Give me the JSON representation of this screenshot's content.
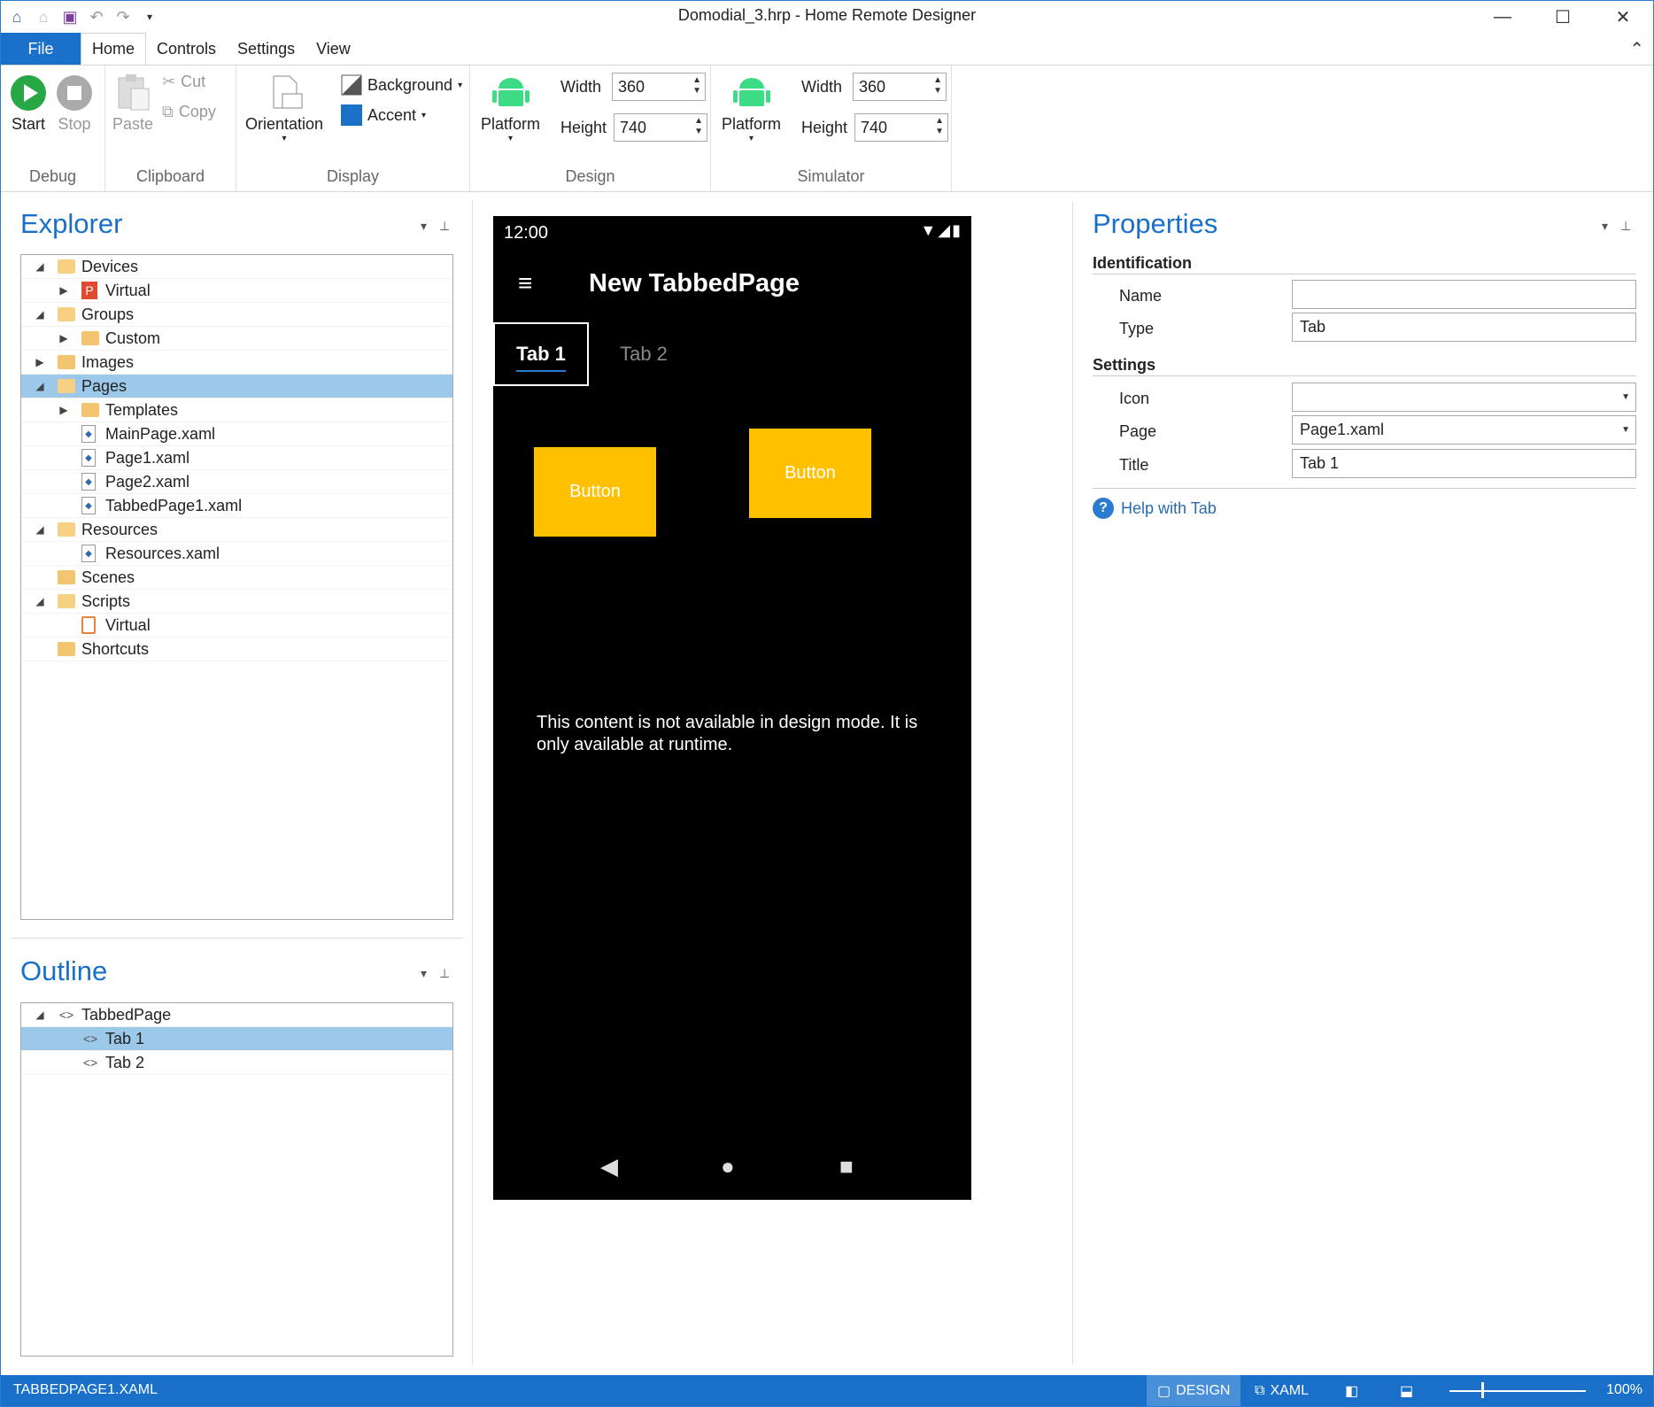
{
  "app": {
    "title": "Domodial_3.hrp - Home Remote Designer"
  },
  "window_controls": {
    "minimize": "—",
    "maximize": "☐",
    "close": "✕"
  },
  "ribbon_tabs": [
    "File",
    "Home",
    "Controls",
    "Settings",
    "View"
  ],
  "ribbon": {
    "debug": {
      "label": "Debug",
      "start": "Start",
      "stop": "Stop"
    },
    "clipboard": {
      "label": "Clipboard",
      "paste": "Paste",
      "cut": "Cut",
      "copy": "Copy"
    },
    "display": {
      "label": "Display",
      "orientation": "Orientation",
      "background": "Background",
      "accent": "Accent",
      "accent_color": "#1a70c8"
    },
    "design": {
      "label": "Design",
      "platform": "Platform",
      "width_label": "Width",
      "width": "360",
      "height_label": "Height",
      "height": "740"
    },
    "simulator": {
      "label": "Simulator",
      "platform": "Platform",
      "width_label": "Width",
      "width": "360",
      "height_label": "Height",
      "height": "740"
    }
  },
  "explorer": {
    "title": "Explorer",
    "items": [
      {
        "label": "Devices",
        "level": 0,
        "expander": "open",
        "icon": "folder-open"
      },
      {
        "label": "Virtual",
        "level": 1,
        "expander": "closed",
        "icon": "plugin-p"
      },
      {
        "label": "Groups",
        "level": 0,
        "expander": "open",
        "icon": "folder-open"
      },
      {
        "label": "Custom",
        "level": 1,
        "expander": "closed",
        "icon": "folder"
      },
      {
        "label": "Images",
        "level": 0,
        "expander": "closed",
        "icon": "folder"
      },
      {
        "label": "Pages",
        "level": 0,
        "expander": "open",
        "icon": "folder-open"
      },
      {
        "label": "Templates",
        "level": 1,
        "expander": "closed",
        "icon": "folder"
      },
      {
        "label": "MainPage.xaml",
        "level": 1,
        "expander": "none",
        "icon": "xaml-file"
      },
      {
        "label": "Page1.xaml",
        "level": 1,
        "expander": "none",
        "icon": "xaml-file"
      },
      {
        "label": "Page2.xaml",
        "level": 1,
        "expander": "none",
        "icon": "xaml-file"
      },
      {
        "label": "TabbedPage1.xaml",
        "level": 1,
        "expander": "none",
        "icon": "xaml-file"
      },
      {
        "label": "Resources",
        "level": 0,
        "expander": "open",
        "icon": "folder-open"
      },
      {
        "label": "Resources.xaml",
        "level": 1,
        "expander": "none",
        "icon": "xaml-file"
      },
      {
        "label": "Scenes",
        "level": 0,
        "expander": "none",
        "icon": "folder"
      },
      {
        "label": "Scripts",
        "level": 0,
        "expander": "open",
        "icon": "folder-open"
      },
      {
        "label": "Virtual",
        "level": 1,
        "expander": "none",
        "icon": "script-file"
      },
      {
        "label": "Shortcuts",
        "level": 0,
        "expander": "none",
        "icon": "folder"
      }
    ],
    "selected": "Pages"
  },
  "outline": {
    "title": "Outline",
    "items": [
      {
        "label": "TabbedPage",
        "level": 0,
        "expander": "open"
      },
      {
        "label": "Tab 1",
        "level": 1,
        "expander": "none"
      },
      {
        "label": "Tab 2",
        "level": 1,
        "expander": "none"
      }
    ],
    "selected": "Tab 1"
  },
  "designer": {
    "time": "12:00",
    "page_title": "New TabbedPage",
    "tabs": [
      "Tab 1",
      "Tab 2"
    ],
    "button1": "Button",
    "button2": "Button",
    "runtime_message": "This content is not available in design mode. It is only available at runtime.",
    "button_color": "#ffc000"
  },
  "properties": {
    "title": "Properties",
    "identification": "Identification",
    "name_label": "Name",
    "name_value": "",
    "type_label": "Type",
    "type_value": "Tab",
    "settings": "Settings",
    "icon_label": "Icon",
    "icon_value": "",
    "page_label": "Page",
    "page_value": "Page1.xaml",
    "title_label": "Title",
    "title_value": "Tab 1",
    "help": "Help with Tab"
  },
  "statusbar": {
    "file": "TABBEDPAGE1.XAML",
    "design": "DESIGN",
    "xaml": "XAML",
    "zoom": "100%"
  }
}
